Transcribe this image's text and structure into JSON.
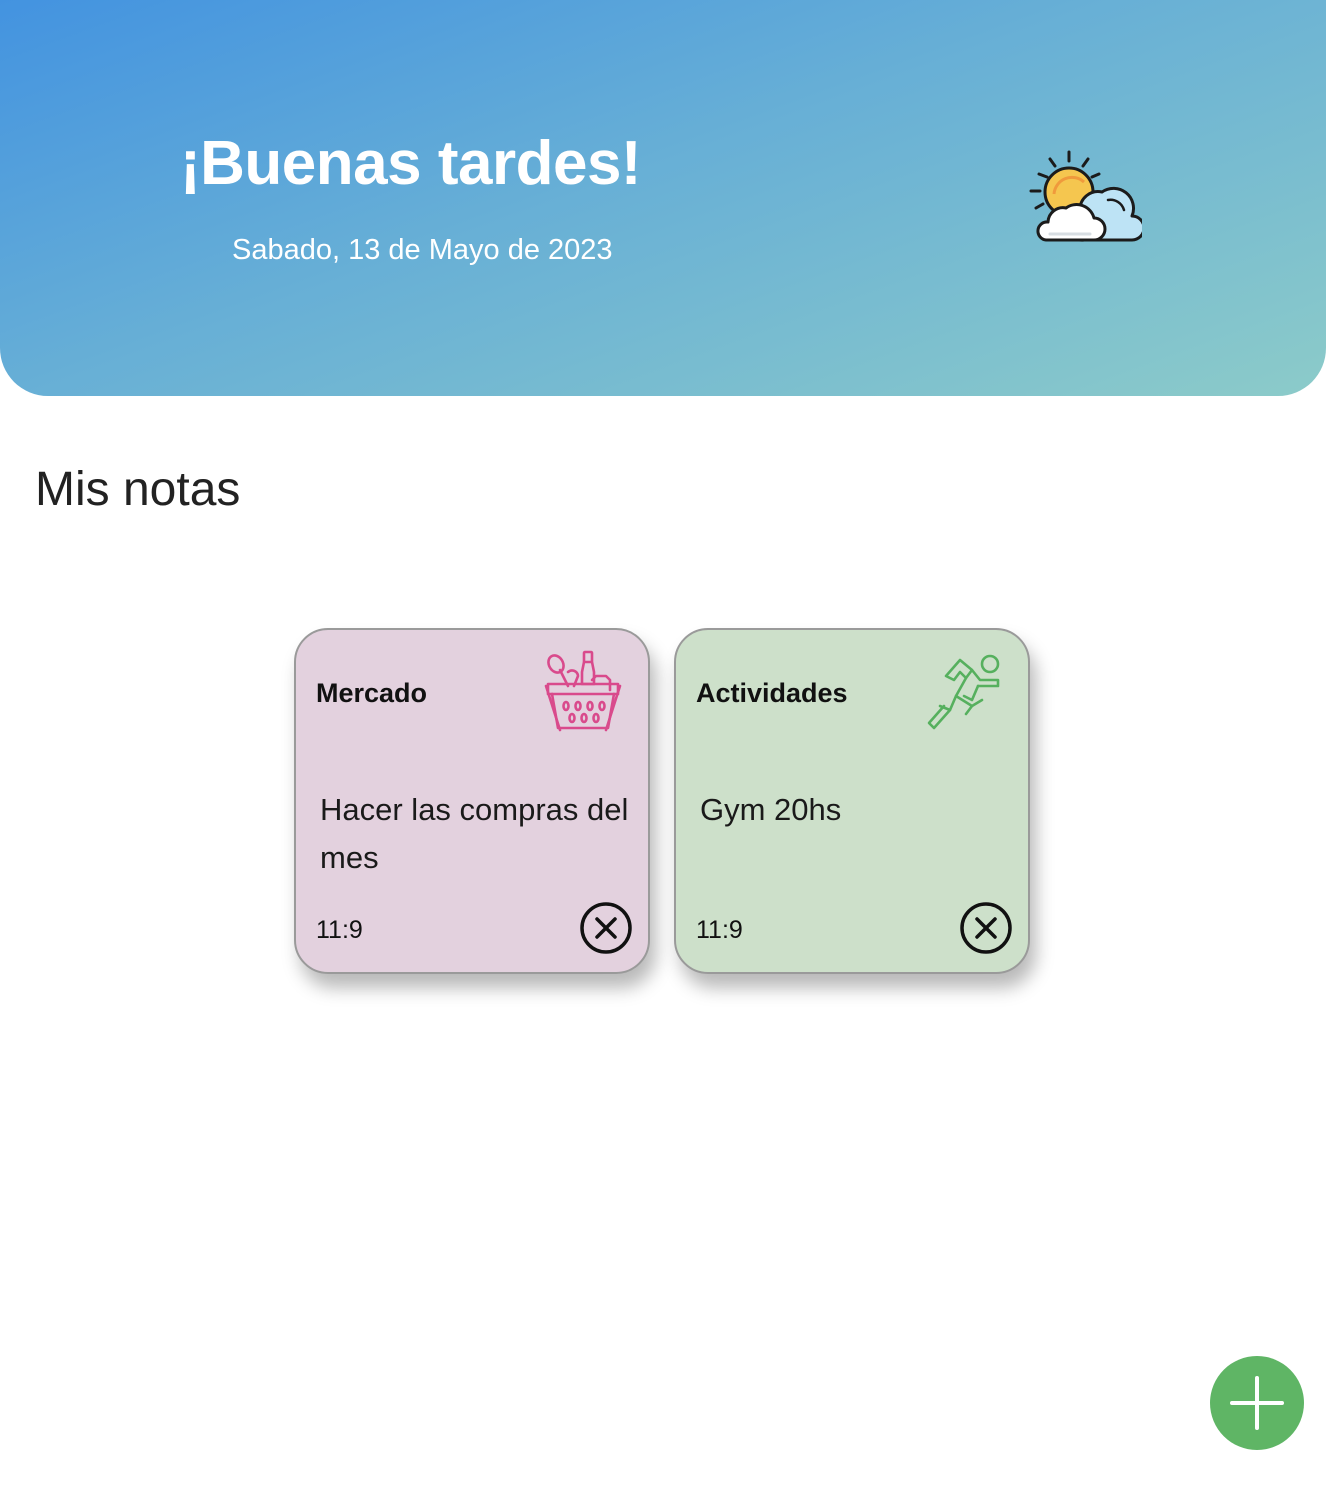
{
  "header": {
    "greeting": "¡Buenas tardes!",
    "date": "Sabado, 13 de Mayo de 2023",
    "weather_icon": "partly-cloudy-icon"
  },
  "section": {
    "title": "Mis notas"
  },
  "notes": [
    {
      "title": "Mercado",
      "text": "Hacer las compras del mes",
      "time": "11:9",
      "icon": "shopping-basket-icon",
      "background": "#e3d1de",
      "icon_color": "#d94a8c"
    },
    {
      "title": "Actividades",
      "text": "Gym 20hs",
      "time": "11:9",
      "icon": "running-person-icon",
      "background": "#cde0ca",
      "icon_color": "#56b05e"
    }
  ],
  "fab": {
    "icon": "plus-icon",
    "color": "#5fb565"
  },
  "colors": {
    "header_gradient_start": "#4393e0",
    "header_gradient_end": "#8ccbc9"
  }
}
